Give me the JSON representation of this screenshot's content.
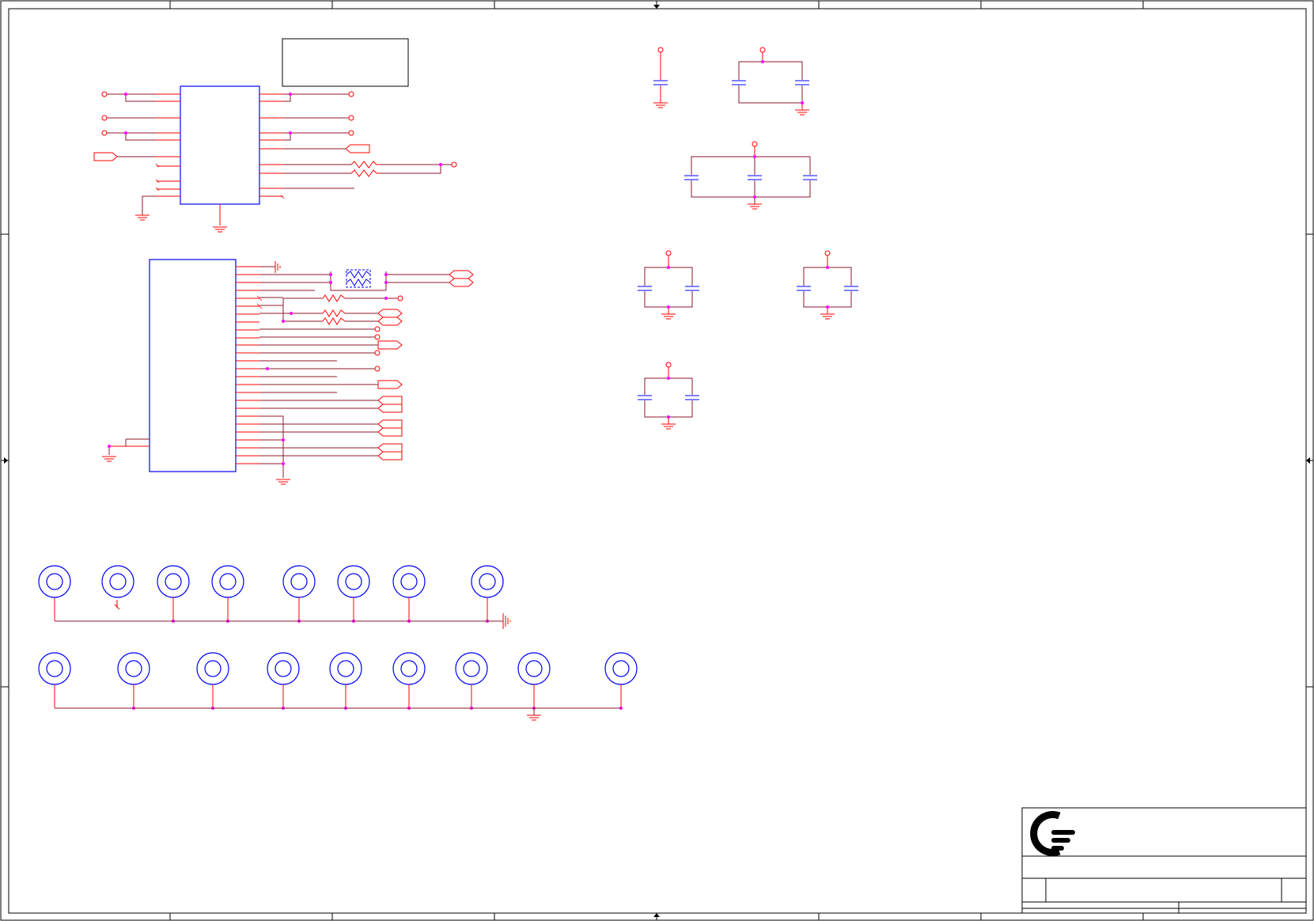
{
  "sheet": {
    "frame_color": "#000000",
    "wire_color": "#8b1a2e",
    "pin_color": "#ff0000",
    "component_color": "#0000ff",
    "junction_color": "#ff00ff",
    "grid_columns": 8,
    "grid_rows": 4
  },
  "title_block": {
    "logo": "company-logo-icon"
  },
  "schematic": {
    "ic_count": 2,
    "mounting_holes_row1": 8,
    "mounting_holes_row2": 9
  }
}
